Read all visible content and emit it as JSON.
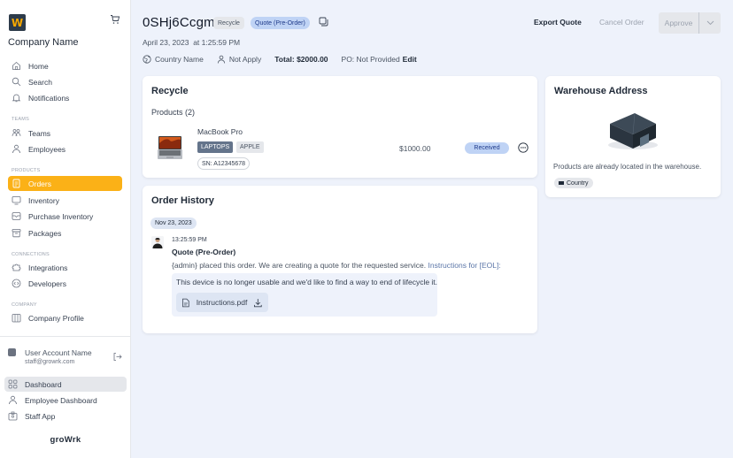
{
  "sidebar": {
    "logo_letter": "W",
    "company_name": "Company Name",
    "main_items": [
      {
        "label": "Home",
        "icon": "home-icon"
      },
      {
        "label": "Search",
        "icon": "search-icon"
      },
      {
        "label": "Notifications",
        "icon": "bell-icon"
      }
    ],
    "sections": {
      "teams": "TEAMS",
      "products": "PRODUCTS",
      "connections": "CONNECTIONS",
      "company": "COMPANY"
    },
    "teams_items": [
      {
        "label": "Teams"
      },
      {
        "label": "Employees"
      }
    ],
    "products_items": [
      {
        "label": "Orders",
        "active": true
      },
      {
        "label": "Inventory"
      },
      {
        "label": "Purchase Inventory"
      },
      {
        "label": "Packages"
      }
    ],
    "connections_items": [
      {
        "label": "Integrations"
      },
      {
        "label": "Developers"
      }
    ],
    "company_items": [
      {
        "label": "Company Profile"
      }
    ],
    "user": {
      "name": "User Account Name",
      "email": "staff@growrk.com"
    },
    "bottom_items": [
      {
        "label": "Dashboard",
        "active": true
      },
      {
        "label": "Employee Dashboard"
      },
      {
        "label": "Staff App"
      }
    ],
    "brand": "groWrk",
    "accent_color": "#fbb117"
  },
  "header": {
    "order_id": "0SHj6Ccgmd",
    "type_badge": "Recycle",
    "status_badge": "Quote (Pre-Order)",
    "date": "April 23, 2023",
    "time": "at 1:25:59 PM",
    "country": "Country Name",
    "assignee": "Not Apply",
    "total": "Total: $2000.00",
    "po": "PO: Not Provided",
    "edit_label": "Edit",
    "actions": {
      "export": "Export Quote",
      "cancel": "Cancel Order",
      "approve": "Approve"
    }
  },
  "recycle_card": {
    "title": "Recycle",
    "products_label": "Products (2)",
    "product": {
      "name": "MacBook Pro",
      "tags": [
        "LAPTOPS",
        "APPLE"
      ],
      "serial": "SN: A12345678",
      "price": "$1000.00",
      "status": "Received"
    }
  },
  "order_history": {
    "title": "Order History",
    "date_chip": "Nov 23, 2023",
    "entry": {
      "time": "13:25:59 PM",
      "title": "Quote (Pre-Order)",
      "text": "{admin} placed this order. We are creating a quote for the requested service.",
      "link": "Instructions for [EOL]:",
      "note": "This device is no longer usable and we'd like to find a way to end of lifecycle it.",
      "attachment": "Instructions.pdf"
    }
  },
  "warehouse": {
    "title": "Warehouse Address",
    "text": "Products are already located in the warehouse.",
    "country": "Country"
  }
}
